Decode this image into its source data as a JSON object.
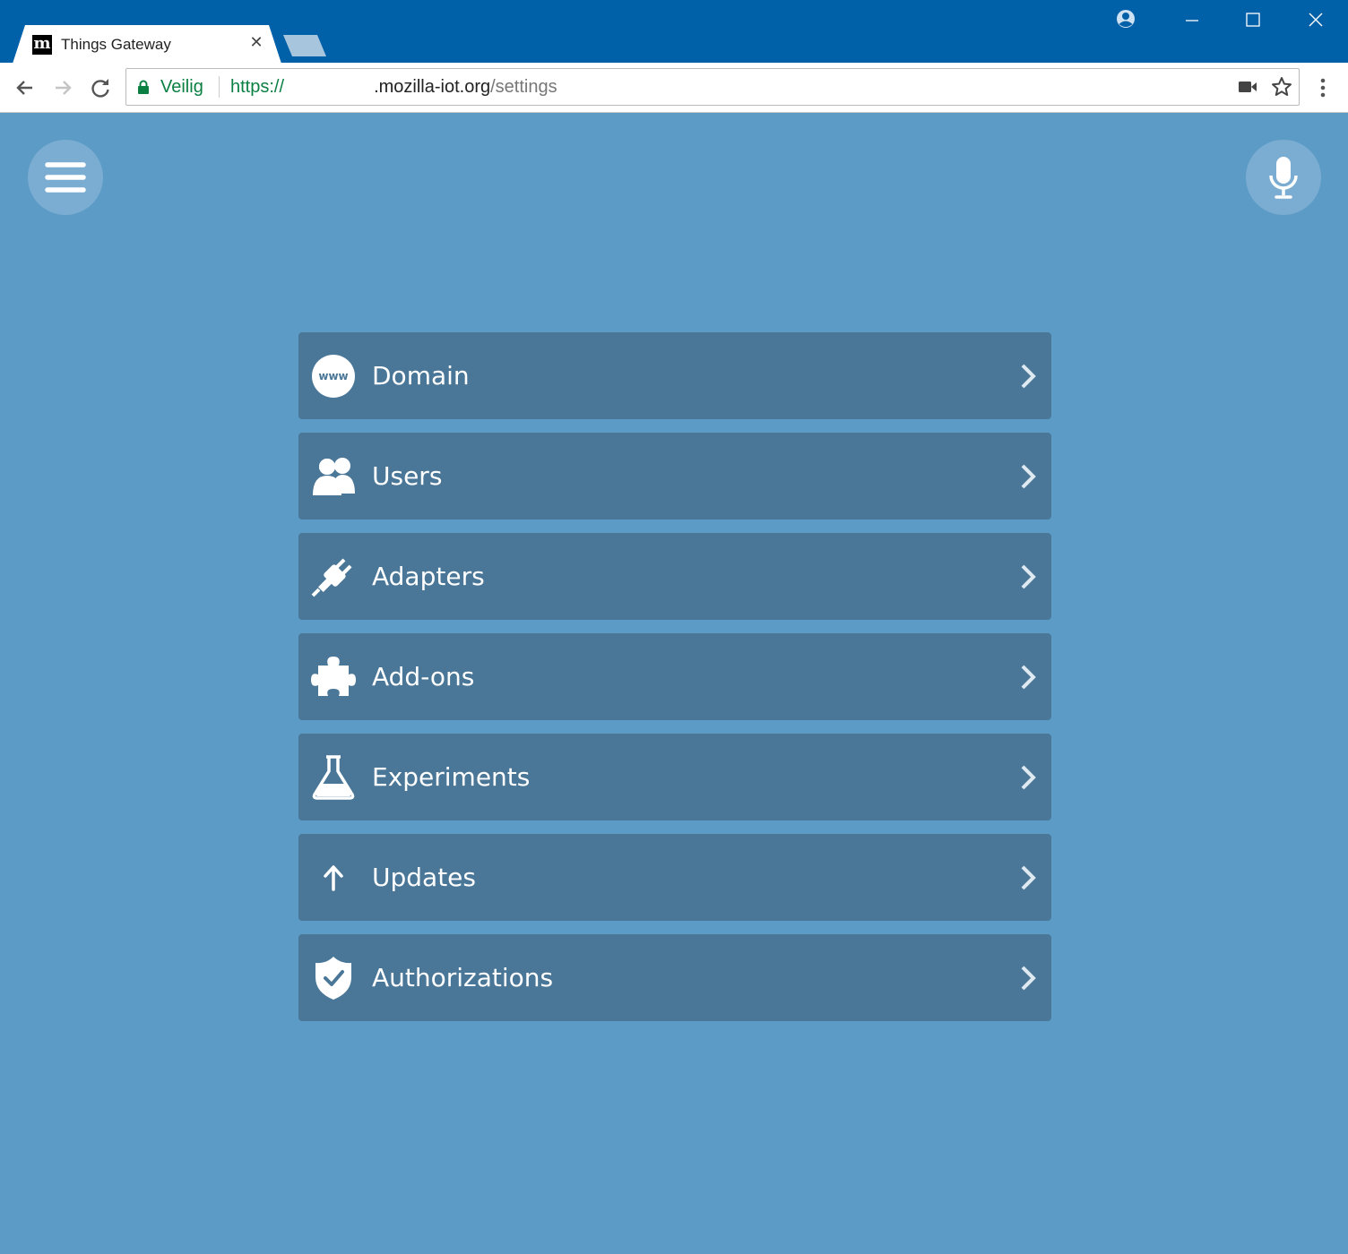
{
  "browser": {
    "tab_title": "Things Gateway",
    "tab_favicon": "m",
    "tab_close": "✕",
    "secure_label": "Veilig",
    "url_scheme": "https://",
    "url_host": ".mozilla-iot.org",
    "url_path": "/settings",
    "colors": {
      "titlebar": "#0060a8",
      "secure": "#0b8043"
    }
  },
  "app": {
    "background": "#5d9bc7",
    "menu_icon": "hamburger-icon",
    "mic_icon": "microphone-icon",
    "settings": [
      {
        "label": "Domain",
        "icon": "www-icon"
      },
      {
        "label": "Users",
        "icon": "users-icon"
      },
      {
        "label": "Adapters",
        "icon": "plug-icon"
      },
      {
        "label": "Add-ons",
        "icon": "puzzle-icon"
      },
      {
        "label": "Experiments",
        "icon": "flask-icon"
      },
      {
        "label": "Updates",
        "icon": "arrow-up-icon"
      },
      {
        "label": "Authorizations",
        "icon": "shield-check-icon"
      }
    ]
  }
}
